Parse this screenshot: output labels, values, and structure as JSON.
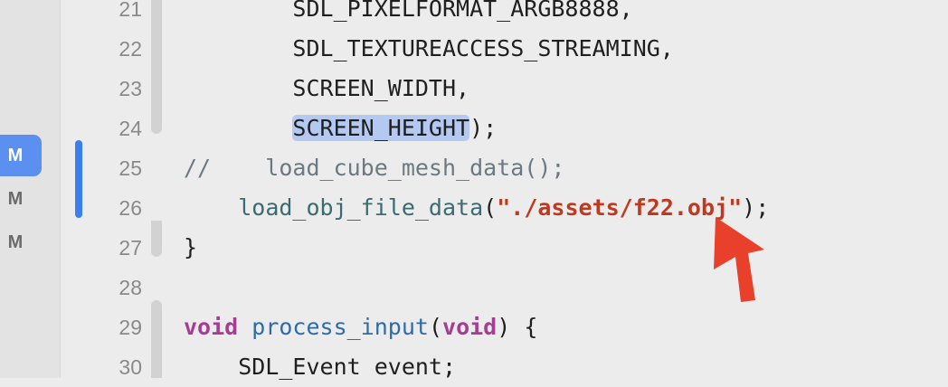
{
  "sidebar": {
    "badges": [
      {
        "label": "M",
        "state": "selected"
      },
      {
        "label": "M",
        "state": "normal"
      },
      {
        "label": "M",
        "state": "normal"
      }
    ]
  },
  "editor": {
    "lines": [
      {
        "num": "21",
        "segments": [
          {
            "text": "        SDL_PIXELFORMAT_ARGB8888,",
            "style": "plain"
          }
        ]
      },
      {
        "num": "22",
        "segments": [
          {
            "text": "        SDL_TEXTUREACCESS_STREAMING,",
            "style": "plain"
          }
        ]
      },
      {
        "num": "23",
        "segments": [
          {
            "text": "        SCREEN_WIDTH,",
            "style": "plain"
          }
        ]
      },
      {
        "num": "24",
        "segments": [
          {
            "text": "        ",
            "style": "plain"
          },
          {
            "text": "SCREEN_HEIGHT",
            "style": "highlight"
          },
          {
            "text": ");",
            "style": "plain"
          }
        ]
      },
      {
        "num": "25",
        "segments": [
          {
            "text": "//    load_cube_mesh_data();",
            "style": "comment"
          }
        ]
      },
      {
        "num": "26",
        "segments": [
          {
            "text": "    ",
            "style": "plain"
          },
          {
            "text": "load_obj_file_data",
            "style": "function"
          },
          {
            "text": "(",
            "style": "plain"
          },
          {
            "text": "\"./assets/f22.obj\"",
            "style": "string"
          },
          {
            "text": ");",
            "style": "plain"
          }
        ]
      },
      {
        "num": "27",
        "segments": [
          {
            "text": "}",
            "style": "plain"
          }
        ]
      },
      {
        "num": "28",
        "segments": [
          {
            "text": "",
            "style": "plain"
          }
        ]
      },
      {
        "num": "29",
        "segments": [
          {
            "text": "void",
            "style": "keyword"
          },
          {
            "text": " ",
            "style": "plain"
          },
          {
            "text": "process_input",
            "style": "type"
          },
          {
            "text": "(",
            "style": "plain"
          },
          {
            "text": "void",
            "style": "keyword"
          },
          {
            "text": ") {",
            "style": "plain"
          }
        ]
      },
      {
        "num": "30",
        "segments": [
          {
            "text": "    SDL_Event event;",
            "style": "plain"
          }
        ]
      }
    ]
  },
  "annotation": {
    "icon": "red-pointer-arrow-icon",
    "color": "#e8402a"
  },
  "colors": {
    "selected_badge": "#5b8ff0",
    "change_bar": "#3a7ef0",
    "string": "#c0391f",
    "keyword": "#a63c94"
  }
}
